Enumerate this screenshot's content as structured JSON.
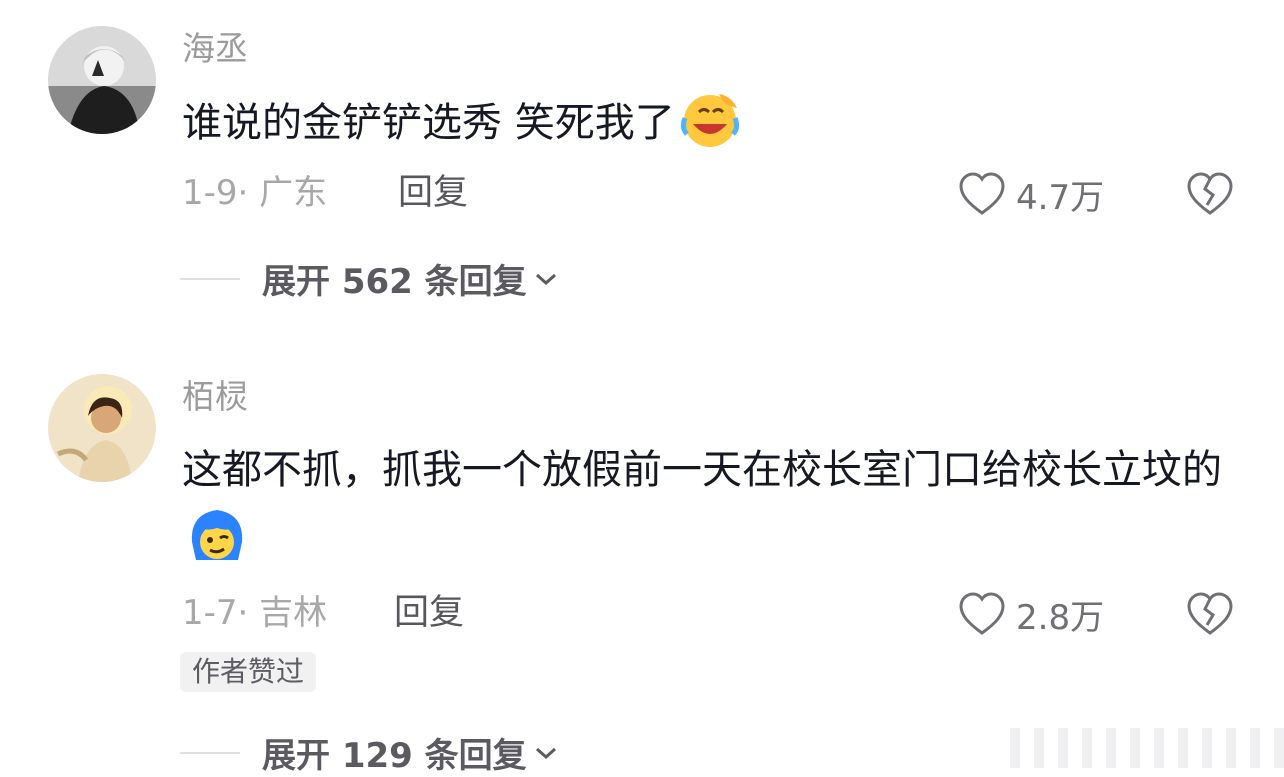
{
  "comments": [
    {
      "username": "海丞",
      "content": "谁说的金铲铲选秀 笑死我了",
      "emoji": "laughing-crying-emoji",
      "meta": "1-9· 广东",
      "reply_label": "回复",
      "like_count": "4.7万",
      "expand_label": "展开 562 条回复"
    },
    {
      "username": "栢棂",
      "content": "这都不抓，抓我一个放假前一天在校长室门口给校长立坟的",
      "emoji": "blue-hair-face-emoji",
      "meta": "1-7· 吉林",
      "reply_label": "回复",
      "like_count": "2.8万",
      "author_badge": "作者赞过",
      "expand_label": "展开 129 条回复"
    }
  ]
}
